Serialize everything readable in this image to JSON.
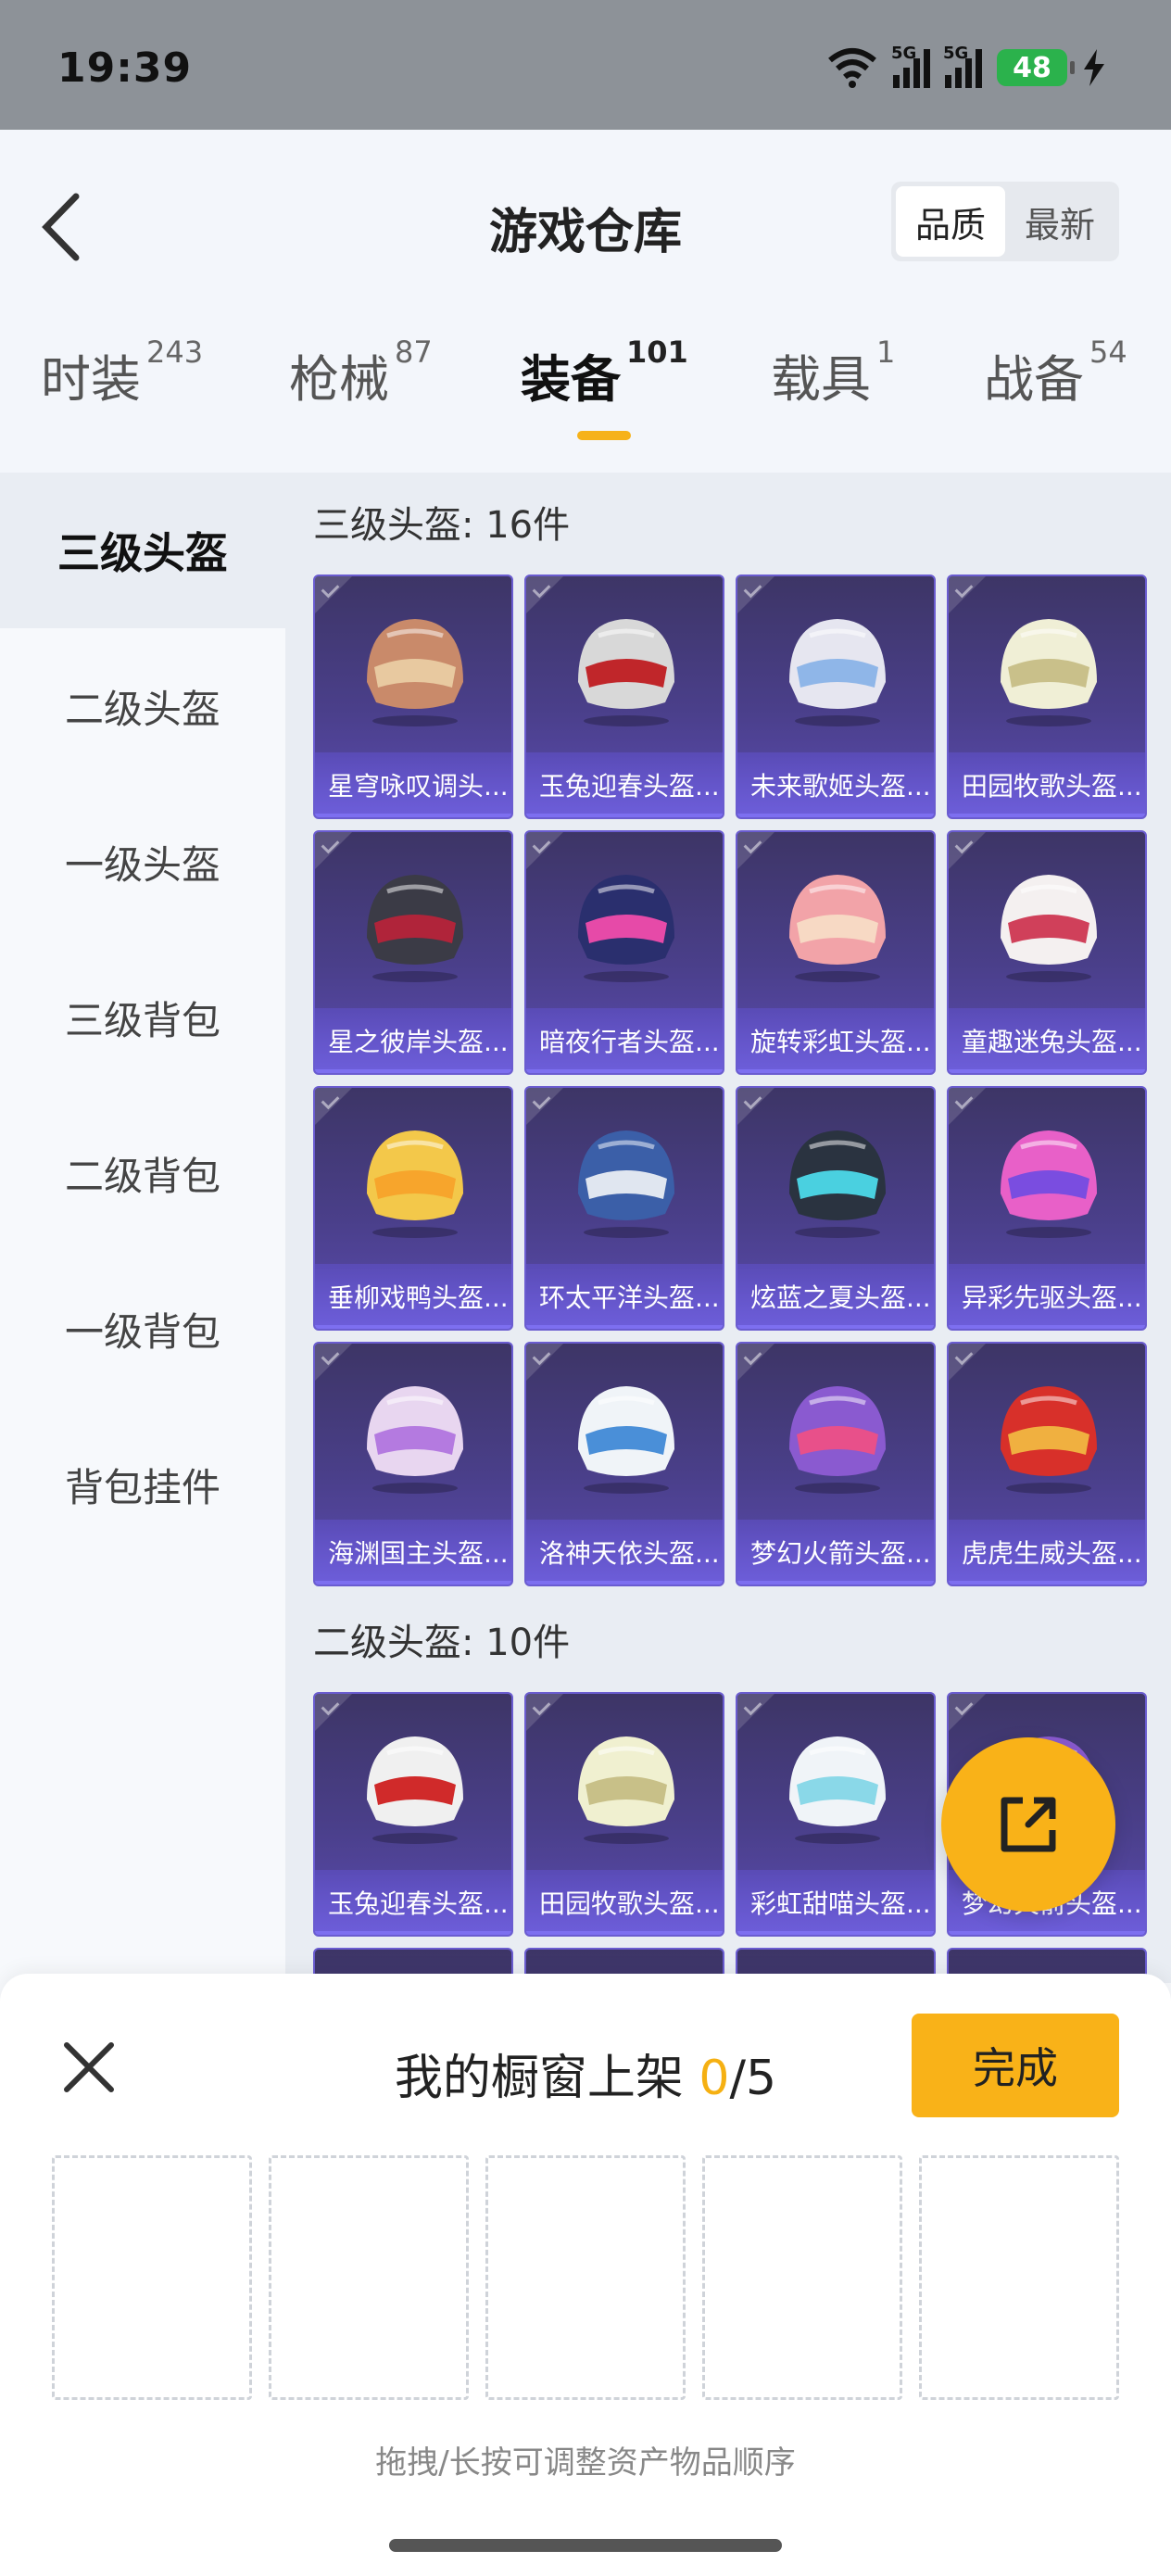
{
  "status_bar": {
    "time": "19:39",
    "battery": "48",
    "sig1": "5G",
    "sig2": "5G"
  },
  "header": {
    "title": "游戏仓库",
    "sort": [
      "品质",
      "最新"
    ]
  },
  "tabs": [
    {
      "label": "时装",
      "count": "243"
    },
    {
      "label": "枪械",
      "count": "87"
    },
    {
      "label": "装备",
      "count": "101"
    },
    {
      "label": "载具",
      "count": "1"
    },
    {
      "label": "战备",
      "count": "54"
    }
  ],
  "sidebar": [
    "三级头盔",
    "二级头盔",
    "一级头盔",
    "三级背包",
    "二级背包",
    "一级背包",
    "背包挂件"
  ],
  "sections": [
    {
      "title": "三级头盔: 16件",
      "items": [
        "星穹咏叹调头...",
        "玉兔迎春头盔...",
        "未来歌姬头盔...",
        "田园牧歌头盔...",
        "星之彼岸头盔...",
        "暗夜行者头盔...",
        "旋转彩虹头盔...",
        "童趣迷兔头盔...",
        "垂柳戏鸭头盔...",
        "环太平洋头盔...",
        "炫蓝之夏头盔...",
        "异彩先驱头盔...",
        "海渊国主头盔...",
        "洛神天依头盔...",
        "梦幻火箭头盔...",
        "虎虎生威头盔..."
      ]
    },
    {
      "title": "二级头盔: 10件",
      "items": [
        "玉兔迎春头盔...",
        "田园牧歌头盔...",
        "彩虹甜喵头盔...",
        "梦幻火箭头盔..."
      ]
    }
  ],
  "sheet": {
    "title": "我的橱窗上架 ",
    "count_current": "0",
    "count_total": "/5",
    "done_label": "完成",
    "hint": "拖拽/长按可调整资产物品顺序"
  },
  "colors": {
    "accent": "#f9b218",
    "card_top": "#3d3566",
    "card_bottom": "#5b4bb0"
  },
  "helmet_colors": [
    [
      "#c98a6a",
      "#e8c9a0"
    ],
    [
      "#d8d8d8",
      "#c0262a"
    ],
    [
      "#e6e6f0",
      "#8fb6e8"
    ],
    [
      "#f0efd6",
      "#c9c08a"
    ],
    [
      "#3b3b46",
      "#b0243a"
    ],
    [
      "#2a2f6e",
      "#e64aa8"
    ],
    [
      "#f2a3a8",
      "#f7d9c4"
    ],
    [
      "#f4f0f0",
      "#d0405a"
    ],
    [
      "#f3c84a",
      "#f7a52c"
    ],
    [
      "#3b5fa8",
      "#e0e6f0"
    ],
    [
      "#2a3340",
      "#4ad0e0"
    ],
    [
      "#e860c8",
      "#7a4de0"
    ],
    [
      "#e8d6f0",
      "#b47ae0"
    ],
    [
      "#f0f4f8",
      "#4a8fd8"
    ],
    [
      "#8a5ad0",
      "#e8508a"
    ],
    [
      "#d8302a",
      "#f0b040"
    ],
    [
      "#f0f0f0",
      "#d02a2a"
    ],
    [
      "#f0f0d0",
      "#c8c088"
    ],
    [
      "#f0f4f8",
      "#8ad8e8"
    ],
    [
      "#8a5ad0",
      "#e8508a"
    ]
  ]
}
